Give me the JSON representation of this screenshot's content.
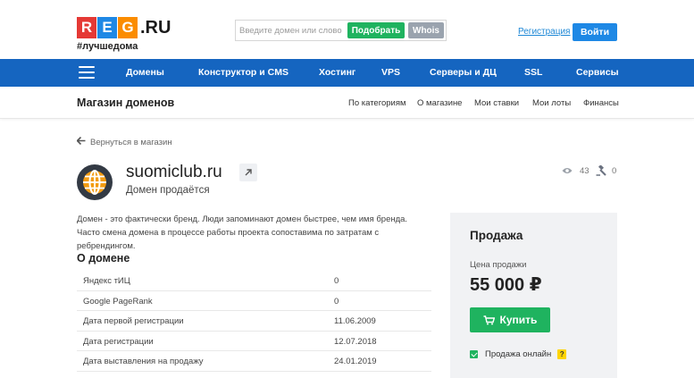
{
  "header": {
    "logo_letters": [
      "R",
      "E",
      "G"
    ],
    "logo_colors": [
      "#e53935",
      "#1e88e5",
      "#fb8c00"
    ],
    "logo_suffix": ".RU",
    "tagline": "#лучшедома",
    "search": {
      "placeholder": "Введите домен или слово",
      "pick_label": "Подобрать",
      "whois_label": "Whois"
    },
    "register_label": "Регистрация",
    "login_label": "Войти"
  },
  "nav": {
    "items": [
      "Домены",
      "Конструктор и CMS",
      "Хостинг",
      "VPS",
      "Серверы и ДЦ",
      "SSL",
      "Сервисы"
    ]
  },
  "subnav": {
    "title": "Магазин доменов",
    "links": [
      "По категориям",
      "О магазине",
      "Мои ставки",
      "Мои лоты",
      "Финансы"
    ]
  },
  "back_label": "Вернуться в магазин",
  "domain": {
    "name": "suomiclub.ru",
    "status": "Домен продаётся",
    "views": "43",
    "bids": "0",
    "description": "Домен - это фактически бренд. Люди запоминают домен быстрее, чем имя бренда. Часто смена домена в процессе работы проекта сопоставима по затратам с ребрендингом."
  },
  "about": {
    "title": "О домене",
    "rows": [
      {
        "key": "Яндекс тИЦ",
        "value": "0"
      },
      {
        "key": "Google PageRank",
        "value": "0"
      },
      {
        "key": "Дата первой регистрации",
        "value": "11.06.2009"
      },
      {
        "key": "Дата регистрации",
        "value": "12.07.2018"
      },
      {
        "key": "Дата выставления на продажу",
        "value": "24.01.2019"
      }
    ]
  },
  "sale": {
    "title": "Продажа",
    "price_label": "Цена продажи",
    "price": "55 000 ₽",
    "buy_label": "Купить",
    "online_label": "Продажа онлайн",
    "help": "?"
  },
  "colors": {
    "nav_bg": "#1565c0",
    "accent_green": "#1fb35f",
    "login_blue": "#1e88e5",
    "link_blue": "#1e88d6"
  }
}
